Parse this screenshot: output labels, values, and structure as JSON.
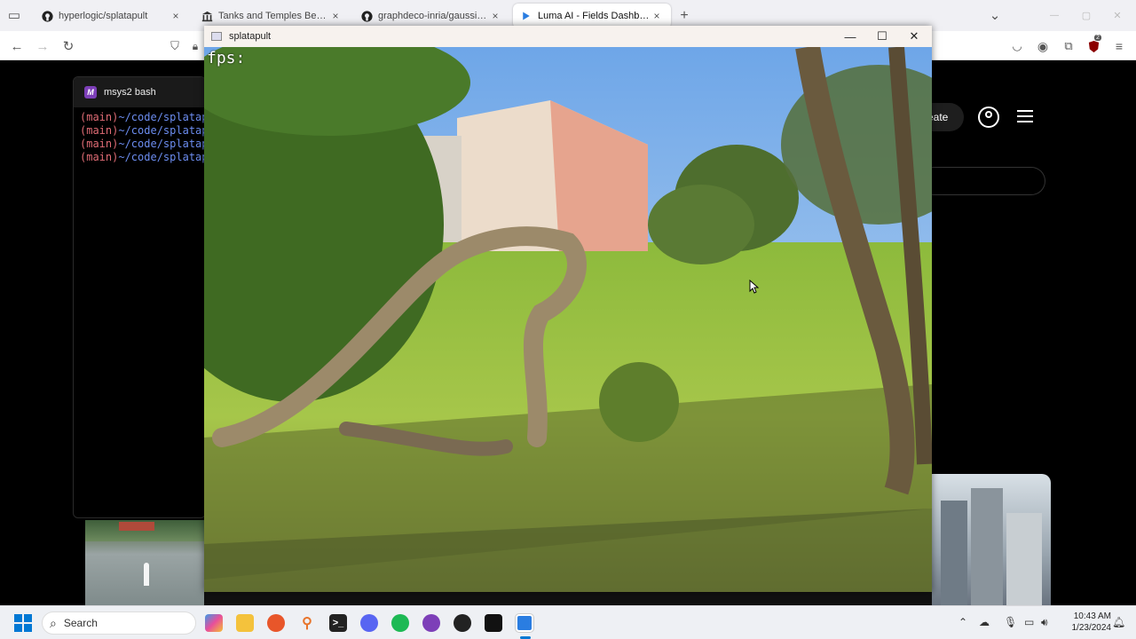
{
  "browser": {
    "tabs": [
      {
        "label": "hyperlogic/splatapult",
        "icon": "github-icon",
        "close": "×"
      },
      {
        "label": "Tanks and Temples Benchmark",
        "icon": "museum-icon",
        "close": "×"
      },
      {
        "label": "graphdeco-inria/gaussian-splatting",
        "icon": "github-icon",
        "close": "×"
      },
      {
        "label": "Luma AI - Fields Dashboard",
        "icon": "luma-icon",
        "close": "×"
      }
    ],
    "new_tab": "+",
    "tab_list": "⌄",
    "window_controls": {
      "minimize": "—",
      "maximize": "▢",
      "close": "✕"
    }
  },
  "terminal": {
    "title": "msys2 bash",
    "logo": "M",
    "lines": [
      {
        "branch": "(main)",
        "path": "~/code/splatapult"
      },
      {
        "branch": "(main)",
        "path": "~/code/splatapult"
      },
      {
        "branch": "(main)",
        "path": "~/code/splatapult"
      },
      {
        "branch": "(main)",
        "path": "~/code/splatapult"
      }
    ]
  },
  "luma": {
    "create_label": "eate"
  },
  "app_window": {
    "title": "splatapult",
    "fps_label": "fps:",
    "controls": {
      "minimize": "—",
      "maximize": "☐",
      "close": "✕"
    }
  },
  "taskbar": {
    "search_placeholder": "Search",
    "time": "10:43 AM",
    "date": "1/23/2024",
    "notification_count": "2"
  },
  "colors": {
    "accent": "#0078d4",
    "terminal_branch": "#e06c75",
    "terminal_path": "#6c8df0"
  }
}
